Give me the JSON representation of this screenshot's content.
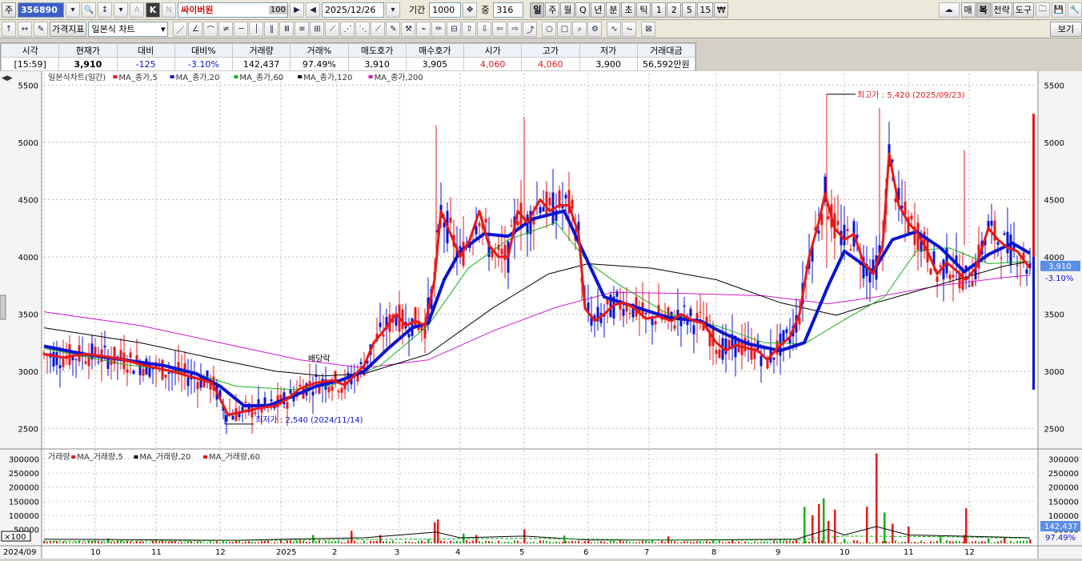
{
  "toolbar1": {
    "market": "주",
    "code": "356890",
    "name": "싸이버원",
    "name_badge": "100",
    "date": "2025/12/26",
    "period_label": "기간",
    "period_value": "1000",
    "count_label": "중",
    "count_value": "316",
    "periods": [
      "일",
      "주",
      "월",
      "Q",
      "년",
      "분",
      "초",
      "틱",
      "1",
      "2",
      "5",
      "15",
      "₩"
    ],
    "right_buttons": [
      "매",
      "복",
      "전략",
      "도구"
    ]
  },
  "toolbar2": {
    "indicator_btn": "가격지표",
    "chart_type": "일본식 차트",
    "view_btn": "보기"
  },
  "quote": {
    "headers": [
      "시각",
      "현재가",
      "대비",
      "대비%",
      "거래량",
      "거래%",
      "매도호가",
      "매수호가",
      "시가",
      "고가",
      "저가",
      "거래대금"
    ],
    "values": [
      "[15:59]",
      "3,910",
      "-125",
      "-3.10%",
      "142,437",
      "97.49%",
      "3,910",
      "3,905",
      "4,060",
      "4,060",
      "3,900",
      "56,592만원"
    ]
  },
  "colors": {
    "red": "#e81818",
    "blue": "#0a14d0",
    "green": "#18b018",
    "black": "#000000",
    "magenta": "#d018d0"
  },
  "chart_data": [
    {
      "type": "candlestick",
      "legend": [
        "일본식차트(일간)",
        "MA_종가,5",
        "MA_종가,20",
        "MA_종가,60",
        "MA_종가,120",
        "MA_종가,200"
      ],
      "ylim": [
        2350,
        5600
      ],
      "yticks": [
        2500,
        3000,
        3500,
        4000,
        4500,
        5000,
        5500
      ],
      "x_labels": [
        "2024/09",
        "10",
        "11",
        "12",
        "2025",
        "2",
        "3",
        "4",
        "5",
        "6",
        "7",
        "8",
        "9",
        "10",
        "11",
        "12"
      ],
      "series": [
        {
          "name": "MA_종가,5",
          "color": "#e81818",
          "points": [
            [
              0,
              3150
            ],
            [
              12,
              3120
            ],
            [
              25,
              3150
            ],
            [
              38,
              3130
            ],
            [
              50,
              3100
            ],
            [
              63,
              3050
            ],
            [
              80,
              3000
            ],
            [
              95,
              2940
            ],
            [
              105,
              2900
            ],
            [
              115,
              2620
            ],
            [
              125,
              2650
            ],
            [
              135,
              2680
            ],
            [
              145,
              2700
            ],
            [
              152,
              2760
            ],
            [
              160,
              2850
            ],
            [
              170,
              2900
            ],
            [
              180,
              2920
            ],
            [
              188,
              2880
            ],
            [
              200,
              3050
            ],
            [
              206,
              3250
            ],
            [
              212,
              3350
            ],
            [
              220,
              3500
            ],
            [
              226,
              3400
            ],
            [
              232,
              3440
            ],
            [
              238,
              3400
            ],
            [
              244,
              3800
            ],
            [
              248,
              4400
            ],
            [
              254,
              4200
            ],
            [
              260,
              4000
            ],
            [
              266,
              4150
            ],
            [
              272,
              4400
            ],
            [
              278,
              4100
            ],
            [
              284,
              4000
            ],
            [
              290,
              4000
            ],
            [
              296,
              4400
            ],
            [
              302,
              4300
            ],
            [
              310,
              4500
            ],
            [
              316,
              4400
            ],
            [
              322,
              4450
            ],
            [
              328,
              4450
            ],
            [
              334,
              4200
            ],
            [
              338,
              3550
            ],
            [
              344,
              3440
            ],
            [
              350,
              3500
            ],
            [
              356,
              3580
            ],
            [
              362,
              3600
            ],
            [
              368,
              3560
            ],
            [
              376,
              3460
            ],
            [
              384,
              3480
            ],
            [
              392,
              3440
            ],
            [
              398,
              3500
            ],
            [
              406,
              3440
            ],
            [
              412,
              3420
            ],
            [
              420,
              3250
            ],
            [
              426,
              3180
            ],
            [
              432,
              3230
            ],
            [
              440,
              3200
            ],
            [
              446,
              3180
            ],
            [
              452,
              3100
            ],
            [
              458,
              3200
            ],
            [
              466,
              3300
            ],
            [
              472,
              3500
            ],
            [
              478,
              4000
            ],
            [
              484,
              4300
            ],
            [
              488,
              4550
            ],
            [
              494,
              4250
            ],
            [
              500,
              4150
            ],
            [
              506,
              4200
            ],
            [
              512,
              3950
            ],
            [
              518,
              3850
            ],
            [
              524,
              4100
            ],
            [
              528,
              4900
            ],
            [
              534,
              4450
            ],
            [
              540,
              4300
            ],
            [
              546,
              4200
            ],
            [
              552,
              4050
            ],
            [
              558,
              3850
            ],
            [
              564,
              3950
            ],
            [
              570,
              3880
            ],
            [
              576,
              3800
            ],
            [
              582,
              3900
            ],
            [
              590,
              4250
            ],
            [
              596,
              4150
            ],
            [
              602,
              4080
            ],
            [
              608,
              4050
            ],
            [
              616,
              3900
            ]
          ]
        },
        {
          "name": "MA_종가,20",
          "color": "#0a14d0",
          "points": [
            [
              0,
              3220
            ],
            [
              25,
              3150
            ],
            [
              50,
              3100
            ],
            [
              75,
              3050
            ],
            [
              95,
              2980
            ],
            [
              110,
              2870
            ],
            [
              125,
              2700
            ],
            [
              140,
              2700
            ],
            [
              155,
              2780
            ],
            [
              170,
              2870
            ],
            [
              185,
              2920
            ],
            [
              200,
              3000
            ],
            [
              215,
              3200
            ],
            [
              230,
              3380
            ],
            [
              240,
              3420
            ],
            [
              250,
              3800
            ],
            [
              260,
              4050
            ],
            [
              275,
              4200
            ],
            [
              290,
              4180
            ],
            [
              305,
              4330
            ],
            [
              325,
              4400
            ],
            [
              335,
              4100
            ],
            [
              350,
              3650
            ],
            [
              370,
              3560
            ],
            [
              390,
              3470
            ],
            [
              410,
              3440
            ],
            [
              425,
              3330
            ],
            [
              440,
              3240
            ],
            [
              460,
              3180
            ],
            [
              475,
              3250
            ],
            [
              490,
              3750
            ],
            [
              500,
              4050
            ],
            [
              510,
              3950
            ],
            [
              518,
              3870
            ],
            [
              530,
              4150
            ],
            [
              545,
              4220
            ],
            [
              560,
              4080
            ],
            [
              575,
              3870
            ],
            [
              590,
              4020
            ],
            [
              605,
              4120
            ],
            [
              616,
              4030
            ]
          ]
        },
        {
          "name": "MA_종가,60",
          "color": "#18b018",
          "points": [
            [
              0,
              3200
            ],
            [
              50,
              3060
            ],
            [
              95,
              2980
            ],
            [
              120,
              2870
            ],
            [
              155,
              2840
            ],
            [
              180,
              2880
            ],
            [
              210,
              3050
            ],
            [
              240,
              3400
            ],
            [
              265,
              3900
            ],
            [
              290,
              4150
            ],
            [
              320,
              4300
            ],
            [
              340,
              3950
            ],
            [
              360,
              3750
            ],
            [
              390,
              3500
            ],
            [
              420,
              3400
            ],
            [
              450,
              3250
            ],
            [
              475,
              3240
            ],
            [
              500,
              3450
            ],
            [
              525,
              3650
            ],
            [
              545,
              4050
            ],
            [
              565,
              4080
            ],
            [
              590,
              3940
            ],
            [
              616,
              3960
            ]
          ]
        },
        {
          "name": "MA_종가,120",
          "color": "#000000",
          "points": [
            [
              0,
              3380
            ],
            [
              60,
              3250
            ],
            [
              110,
              3100
            ],
            [
              145,
              3000
            ],
            [
              175,
              2960
            ],
            [
              200,
              2980
            ],
            [
              240,
              3150
            ],
            [
              280,
              3550
            ],
            [
              315,
              3850
            ],
            [
              340,
              3940
            ],
            [
              380,
              3900
            ],
            [
              420,
              3800
            ],
            [
              460,
              3600
            ],
            [
              495,
              3490
            ],
            [
              520,
              3600
            ],
            [
              560,
              3760
            ],
            [
              600,
              3920
            ],
            [
              616,
              3960
            ]
          ]
        },
        {
          "name": "MA_종가,200",
          "color": "#d018d0",
          "points": [
            [
              0,
              3520
            ],
            [
              60,
              3400
            ],
            [
              110,
              3250
            ],
            [
              160,
              3100
            ],
            [
              200,
              3030
            ],
            [
              240,
              3100
            ],
            [
              280,
              3350
            ],
            [
              320,
              3560
            ],
            [
              355,
              3690
            ],
            [
              400,
              3680
            ],
            [
              450,
              3660
            ],
            [
              490,
              3590
            ],
            [
              520,
              3650
            ],
            [
              560,
              3750
            ],
            [
              600,
              3820
            ],
            [
              616,
              3840
            ]
          ]
        }
      ],
      "annotations": [
        {
          "text": "최고가 : 5,420 (2025/09/23)",
          "x": 489,
          "y": 5420
        },
        {
          "text": "최저가 : 2,540 (2024/11/14)",
          "x": 113,
          "y": 2540
        },
        {
          "text": "배당락",
          "x": 165,
          "y": 2960
        }
      ],
      "current_price": "3,910",
      "current_change": "-3.10%"
    },
    {
      "type": "bar",
      "legend": [
        "거래량",
        "MA_거래량,5",
        "MA_거래량,20",
        "MA_거래량,60"
      ],
      "ylim": [
        0,
        330000
      ],
      "yticks": [
        50000,
        100000,
        150000,
        200000,
        250000,
        300000
      ],
      "ytick_labels": [
        "50000",
        "100000",
        "150000",
        "200000",
        "250000",
        "300000"
      ],
      "y_unit": "×100",
      "spikes": [
        [
          40,
          18000
        ],
        [
          80,
          8000
        ],
        [
          120,
          6000
        ],
        [
          168,
          30000
        ],
        [
          192,
          45000
        ],
        [
          210,
          30000
        ],
        [
          240,
          15000
        ],
        [
          244,
          75000
        ],
        [
          246,
          85000
        ],
        [
          262,
          35000
        ],
        [
          270,
          30000
        ],
        [
          300,
          50000
        ],
        [
          325,
          28000
        ],
        [
          340,
          9000
        ],
        [
          390,
          25000
        ],
        [
          418,
          10000
        ],
        [
          430,
          12000
        ],
        [
          470,
          12000
        ],
        [
          475,
          130000
        ],
        [
          480,
          100000
        ],
        [
          484,
          140000
        ],
        [
          487,
          160000
        ],
        [
          490,
          80000
        ],
        [
          494,
          120000
        ],
        [
          500,
          15000
        ],
        [
          514,
          130000
        ],
        [
          520,
          320000
        ],
        [
          525,
          110000
        ],
        [
          530,
          70000
        ],
        [
          540,
          60000
        ],
        [
          560,
          25000
        ],
        [
          575,
          30000
        ],
        [
          576,
          125000
        ],
        [
          590,
          18000
        ],
        [
          600,
          22000
        ],
        [
          616,
          14000
        ]
      ],
      "current_volume": "142,437",
      "current_ratio": "97.49%"
    }
  ]
}
